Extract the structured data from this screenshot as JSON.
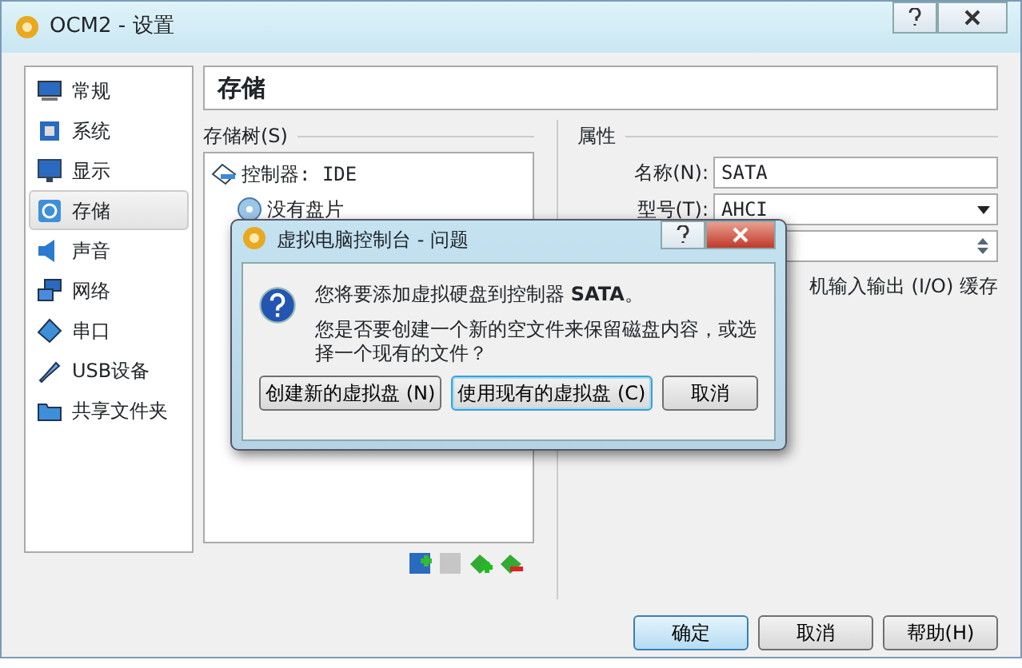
{
  "window": {
    "title": "OCM2 - 设置"
  },
  "sidebar": {
    "items": [
      {
        "label": "常规",
        "selected": false
      },
      {
        "label": "系统",
        "selected": false
      },
      {
        "label": "显示",
        "selected": false
      },
      {
        "label": "存储",
        "selected": true
      },
      {
        "label": "声音",
        "selected": false
      },
      {
        "label": "网络",
        "selected": false
      },
      {
        "label": "串口",
        "selected": false
      },
      {
        "label": "USB设备",
        "selected": false
      },
      {
        "label": "共享文件夹",
        "selected": false
      }
    ]
  },
  "page_title": "存储",
  "storage_tree": {
    "heading": "存储树(S)",
    "items": [
      {
        "label": "控制器: IDE",
        "kind": "controller",
        "children": [
          {
            "label": "没有盘片",
            "kind": "disc"
          }
        ]
      }
    ],
    "tools": [
      {
        "disabled": false
      },
      {
        "disabled": true
      },
      {
        "disabled": false
      },
      {
        "disabled": false
      }
    ]
  },
  "attributes": {
    "heading": "属性",
    "name_label": "名称(N):",
    "name_value": "SATA",
    "type_label": "型号(T):",
    "type_value": "AHCI",
    "cache_label": "机输入输出 (I/O) 缓存"
  },
  "buttons": [
    {
      "label": "确定",
      "default": true
    },
    {
      "label": "取消",
      "default": false
    },
    {
      "label": "帮助(H)",
      "default": false
    }
  ],
  "dialog": {
    "title": "虚拟电脑控制台 - 问题",
    "message": "您将要添加虚拟硬盘到控制器 **SATA**。",
    "question": "您是否要创建一个新的空文件来保留磁盘内容，或选择一个现有的文件？",
    "buttons": [
      {
        "label": "创建新的虚拟盘 (N)",
        "focused": false
      },
      {
        "label": "使用现有的虚拟盘 (C)",
        "focused": true
      },
      {
        "label": "取消",
        "focused": false
      }
    ]
  }
}
